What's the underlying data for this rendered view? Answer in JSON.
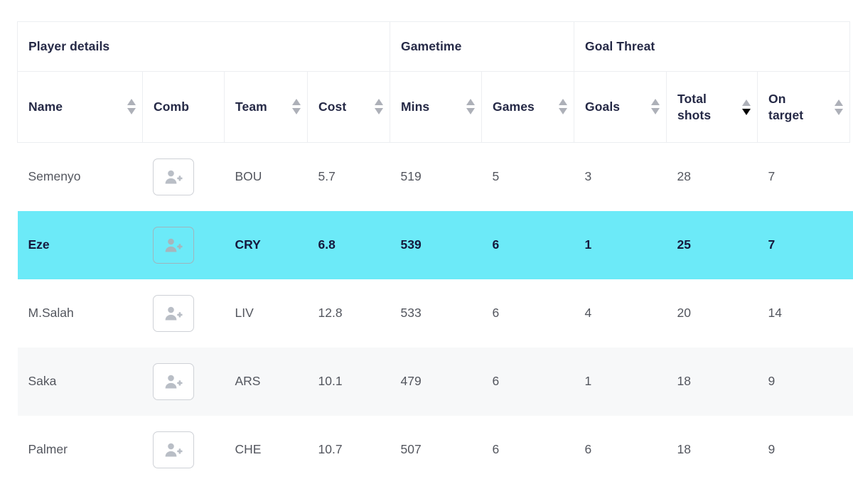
{
  "table": {
    "group_headers": [
      {
        "label": "Player details",
        "colspan": 4
      },
      {
        "label": "Gametime",
        "colspan": 2
      },
      {
        "label": "Goal Threat",
        "colspan": 3
      }
    ],
    "columns": [
      {
        "key": "name",
        "label": "Name",
        "sortable": true,
        "sort": "none",
        "wrap": false
      },
      {
        "key": "comb",
        "label": "Comb",
        "sortable": false,
        "sort": "none",
        "wrap": false
      },
      {
        "key": "team",
        "label": "Team",
        "sortable": true,
        "sort": "none",
        "wrap": false
      },
      {
        "key": "cost",
        "label": "Cost",
        "sortable": true,
        "sort": "none",
        "wrap": false
      },
      {
        "key": "mins",
        "label": "Mins",
        "sortable": true,
        "sort": "none",
        "wrap": false
      },
      {
        "key": "games",
        "label": "Games",
        "sortable": true,
        "sort": "none",
        "wrap": false
      },
      {
        "key": "goals",
        "label": "Goals",
        "sortable": true,
        "sort": "none",
        "wrap": false
      },
      {
        "key": "totalshots",
        "label": "Total shots",
        "sortable": true,
        "sort": "desc",
        "wrap": true
      },
      {
        "key": "ontarget",
        "label": "On target",
        "sortable": true,
        "sort": "none",
        "wrap": true
      }
    ],
    "comb_button": {
      "icon": "add-person-icon",
      "title": "Combine player"
    },
    "rows": [
      {
        "name": "Semenyo",
        "team": "BOU",
        "cost": "5.7",
        "mins": "519",
        "games": "5",
        "goals": "3",
        "totalshots": "28",
        "ontarget": "7",
        "state": "default"
      },
      {
        "name": "Eze",
        "team": "CRY",
        "cost": "6.8",
        "mins": "539",
        "games": "6",
        "goals": "1",
        "totalshots": "25",
        "ontarget": "7",
        "state": "selected"
      },
      {
        "name": "M.Salah",
        "team": "LIV",
        "cost": "12.8",
        "mins": "533",
        "games": "6",
        "goals": "4",
        "totalshots": "20",
        "ontarget": "14",
        "state": "default"
      },
      {
        "name": "Saka",
        "team": "ARS",
        "cost": "10.1",
        "mins": "479",
        "games": "6",
        "goals": "1",
        "totalshots": "18",
        "ontarget": "9",
        "state": "zebra"
      },
      {
        "name": "Palmer",
        "team": "CHE",
        "cost": "10.7",
        "mins": "507",
        "games": "6",
        "goals": "6",
        "totalshots": "18",
        "ontarget": "9",
        "state": "default"
      }
    ]
  },
  "colors": {
    "selected_row": "#6ceaf8",
    "zebra_row": "#f7f8f9",
    "border": "#eceef1",
    "header_text": "#252946",
    "body_text": "#53565e",
    "selected_text": "#16193d",
    "sort_idle": "#adb0b8",
    "sort_active": "#000000"
  }
}
